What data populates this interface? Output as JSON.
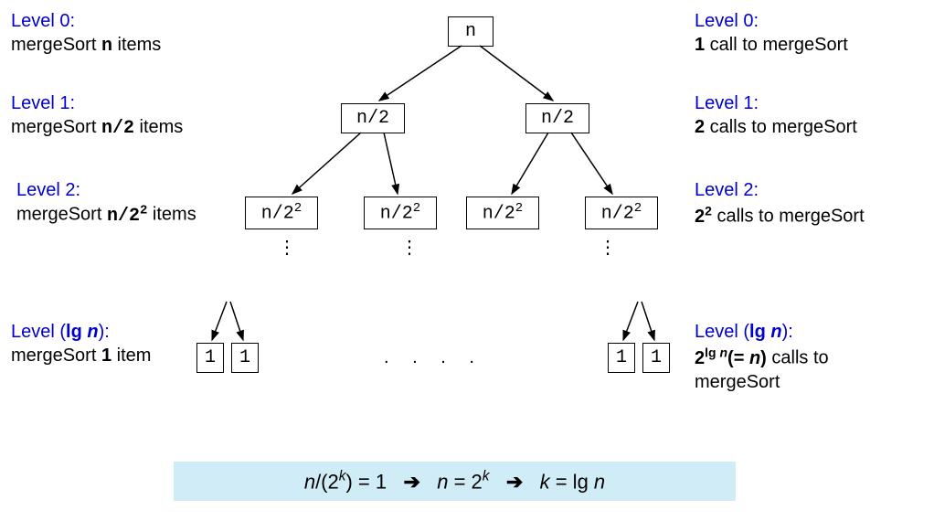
{
  "left": {
    "l0": {
      "title": "Level 0:",
      "desc_prefix": "mergeSort ",
      "desc_val": "n",
      "desc_suffix": " items"
    },
    "l1": {
      "title": "Level 1:",
      "desc_prefix": "mergeSort ",
      "desc_val": "n/2",
      "desc_suffix": " items"
    },
    "l2": {
      "title": "Level 2:",
      "desc_prefix": "mergeSort ",
      "desc_val": "n/2",
      "desc_suffix": " items"
    },
    "lk": {
      "title_prefix": "Level (",
      "title_lg": "lg ",
      "title_n": "n",
      "title_suffix": "):",
      "desc_prefix": "mergeSort ",
      "desc_bold": "1",
      "desc_suffix": " item"
    }
  },
  "right": {
    "l0": {
      "title": "Level 0:",
      "bold": "1",
      "desc": " call to mergeSort"
    },
    "l1": {
      "title": "Level 1:",
      "bold": "2",
      "desc": " calls to mergeSort"
    },
    "l2": {
      "title": "Level 2:",
      "bold": "2",
      "desc": " calls to mergeSort"
    },
    "lk": {
      "title_prefix": "Level (",
      "title_lg": "lg ",
      "title_n": "n",
      "title_suffix": "):",
      "bold_base": "2",
      "bold_eq_open": "(= ",
      "bold_n": "n",
      "bold_eq_close": ")",
      "desc": " calls to",
      "desc2": "mergeSort"
    }
  },
  "nodes": {
    "root": "n",
    "l1a": "n/2",
    "l1b": "n/2",
    "l2a": "n/2",
    "l2b": "n/2",
    "l2c": "n/2",
    "l2d": "n/2",
    "leaf": "1"
  },
  "formula": {
    "p1_n": "n",
    "p1_rest": "/(2",
    "p1_k": "k",
    "p1_end": ") = 1",
    "arrow": "➔",
    "p2_n": "n",
    "p2_eq": " = 2",
    "p2_k": "k",
    "p3_k": "k",
    "p3_eq": " = lg ",
    "p3_n": "n"
  },
  "dots": ". . . ."
}
